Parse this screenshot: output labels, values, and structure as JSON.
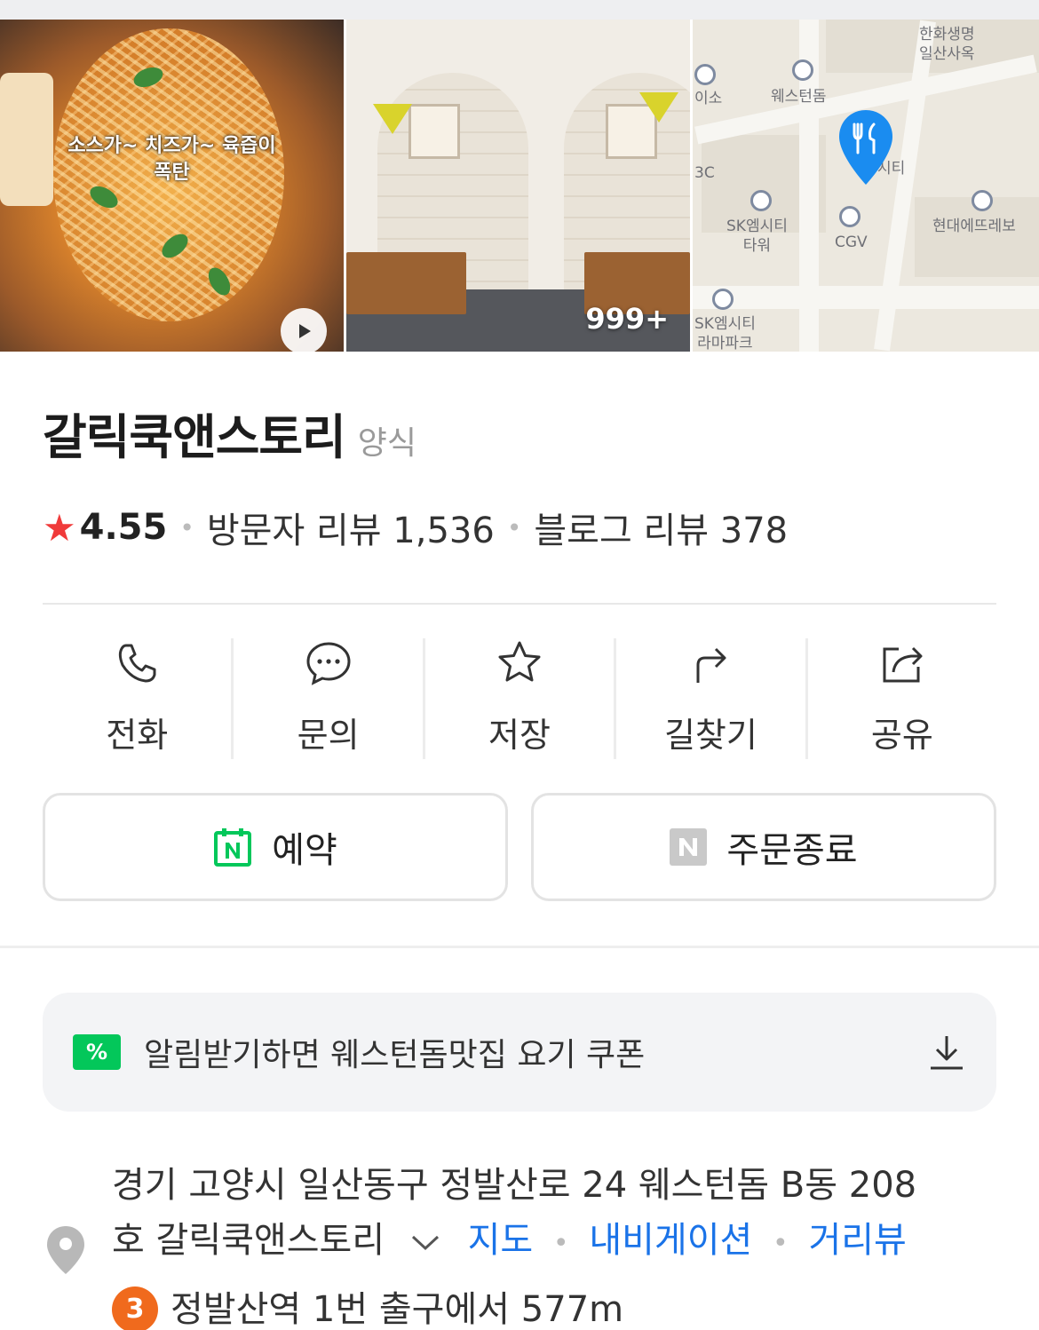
{
  "gallery": {
    "food_caption_line1": "소스가~ 치즈가~ 육즙이",
    "food_caption_line2": "폭탄",
    "photo_count": "999+",
    "map_labels": {
      "label1": "한화생명",
      "label2": "일산사옥",
      "label3": "이소",
      "label4": "웨스턴돔",
      "label5": "3C",
      "label6": "SK엠시티",
      "label7": "타워",
      "label8": "CGV",
      "label9": "현대에뜨레보",
      "label10": "SK엠시티",
      "label11": "라마파크",
      "label12": "시티"
    }
  },
  "place": {
    "name": "갈릭쿡앤스토리",
    "category": "양식",
    "rating": "4.55",
    "visitor_reviews": "방문자 리뷰 1,536",
    "blog_reviews": "블로그 리뷰 378"
  },
  "actions": {
    "call": "전화",
    "inquiry": "문의",
    "save": "저장",
    "directions": "길찾기",
    "share": "공유"
  },
  "cta": {
    "reserve": "예약",
    "order": "주문종료"
  },
  "coupon": {
    "badge": "%",
    "text": "알림받기하면 웨스턴돔맛집 요기 쿠폰"
  },
  "address": {
    "line1": "경기 고양시 일산동구 정발산로 24 웨스턴돔 B동 208",
    "line2_prefix": "호 갈릭쿡앤스토리",
    "map_link": "지도",
    "nav_link": "내비게이션",
    "street_link": "거리뷰",
    "subway_line": "3",
    "subway_text": "정발산역 1번 출구에서 577m"
  },
  "colors": {
    "naver_green": "#03c75a",
    "link_blue": "#1a73e8",
    "star_red": "#f03a3a",
    "line3_orange": "#f06a1d"
  }
}
